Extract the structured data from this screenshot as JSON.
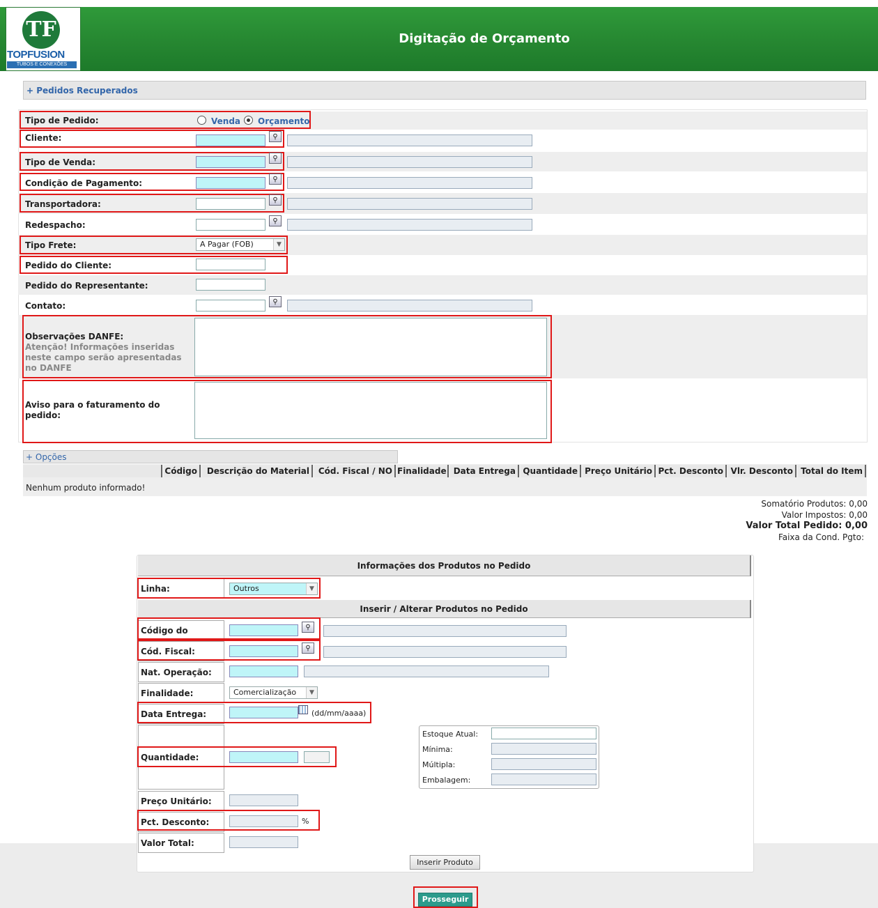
{
  "header": {
    "title": "Digitação de Orçamento",
    "logo_initials": "TF",
    "logo_name": "TOPFUSION",
    "logo_sub": "TUBOS E CONEXÕES"
  },
  "recovered": {
    "link": "+ Pedidos Recuperados"
  },
  "form": {
    "tipo_pedido_label": "Tipo de Pedido:",
    "venda_label": "Venda",
    "orcamento_label": "Orçamento",
    "selected_type": "Orçamento",
    "cliente_label": "Cliente:",
    "tipo_venda_label": "Tipo de Venda:",
    "condicao_label": "Condição de Pagamento:",
    "transportadora_label": "Transportadora:",
    "redespacho_label": "Redespacho:",
    "tipo_frete_label": "Tipo Frete:",
    "tipo_frete_value": "A Pagar (FOB)",
    "pedido_cliente_label": "Pedido do Cliente:",
    "pedido_rep_label": "Pedido do Representante:",
    "contato_label": "Contato:",
    "obs_label": "Observações DANFE:",
    "obs_hint": "Atenção! Informações inseridas neste campo serão apresentadas no DANFE",
    "aviso_label": "Aviso para o faturamento do pedido:"
  },
  "options": {
    "link": "+ Opções"
  },
  "table": {
    "headers": [
      "Código",
      "Descrição do Material",
      "Cód. Fiscal / NO",
      "Finalidade",
      "Data Entrega",
      "Quantidade",
      "Preço Unitário",
      "Pct. Desconto",
      "Vlr. Desconto",
      "Total do Item"
    ],
    "empty": "Nenhum produto informado!"
  },
  "totals": {
    "somatorio": "Somatório Produtos: 0,00",
    "impostos": "Valor Impostos: 0,00",
    "total": "Valor Total Pedido: 0,00",
    "faixa": "Faixa da Cond. Pgto:"
  },
  "products": {
    "info_title": "Informações dos Produtos no Pedido",
    "linha_label": "Linha:",
    "linha_value": "Outros",
    "insert_title": "Inserir / Alterar Produtos no Pedido",
    "codigo_label": "Código do Produto:",
    "cod_fiscal_label": "Cód. Fiscal:",
    "nat_op_label": "Nat. Operação:",
    "finalidade_label": "Finalidade:",
    "finalidade_value": "Comercialização",
    "data_entrega_label": "Data Entrega:",
    "date_format": "(dd/mm/aaaa)",
    "quantidade_label": "Quantidade:",
    "estoque_label": "Estoque Atual:",
    "minima_label": "Mínima:",
    "multipla_label": "Múltipla:",
    "embalagem_label": "Embalagem:",
    "preco_label": "Preço Unitário:",
    "pct_desc_label": "Pct. Desconto:",
    "percent": "%",
    "valor_total_label": "Valor Total:",
    "insert_button": "Inserir Produto"
  },
  "actions": {
    "proceed": "Prosseguir"
  },
  "colors": {
    "header_green": "#268731",
    "input_cyan": "#bff5f8",
    "highlight_red": "#e01818",
    "proceed_teal": "#2c9b8c"
  }
}
